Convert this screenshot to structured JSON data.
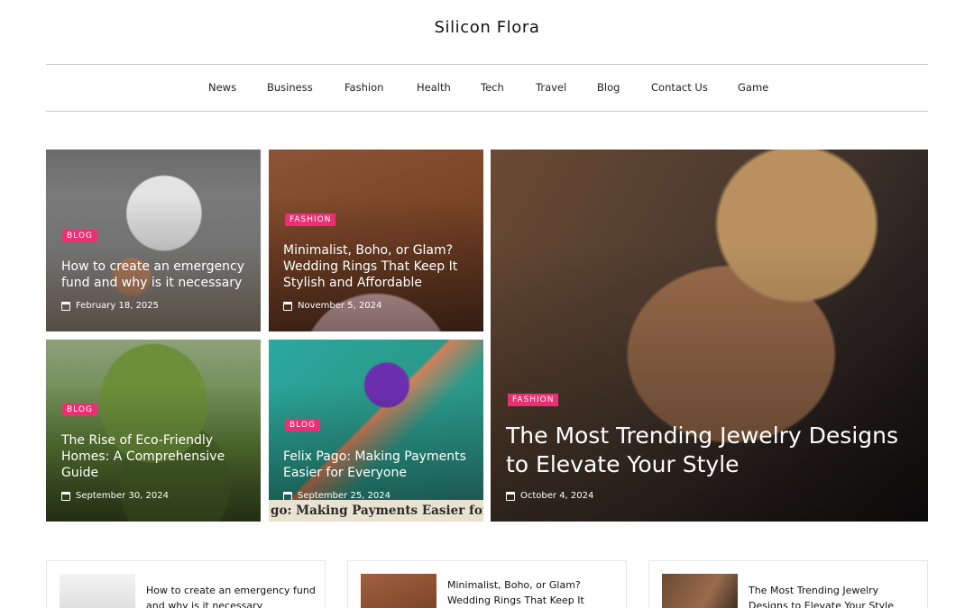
{
  "site": {
    "title": "Silicon Flora"
  },
  "nav": {
    "items": [
      "News",
      "Business",
      "Fashion",
      "Health",
      "Tech",
      "Travel",
      "Blog",
      "Contact Us",
      "Game"
    ]
  },
  "featured": [
    {
      "category": "BLOG",
      "title": "How to create an emergency fund and why is it necessary",
      "date": "February 18, 2025"
    },
    {
      "category": "FASHION",
      "title": "Minimalist, Boho, or Glam? Wedding Rings That Keep It Stylish and Affordable",
      "date": "November 5, 2024"
    },
    {
      "category": "BLOG",
      "title": "The Rise of Eco-Friendly Homes: A Comprehensive Guide",
      "date": "September 30, 2024"
    },
    {
      "category": "BLOG",
      "title": "Felix Pago: Making Payments Easier for Everyone",
      "date": "September 25, 2024",
      "image_caption": "go: Making Payments Easier for Ev"
    },
    {
      "category": "FASHION",
      "title": "The Most Trending Jewelry Designs to Elevate Your Style",
      "date": "October 4, 2024"
    }
  ],
  "bottom_cards": [
    {
      "title": "How to create an emergency fund and why is it necessary"
    },
    {
      "title": "Minimalist, Boho, or Glam? Wedding Rings That Keep It"
    },
    {
      "title": "The Most Trending Jewelry Designs to Elevate Your Style"
    }
  ],
  "colors": {
    "badge": "#ec2f73",
    "rule": "#c9c9c9"
  }
}
